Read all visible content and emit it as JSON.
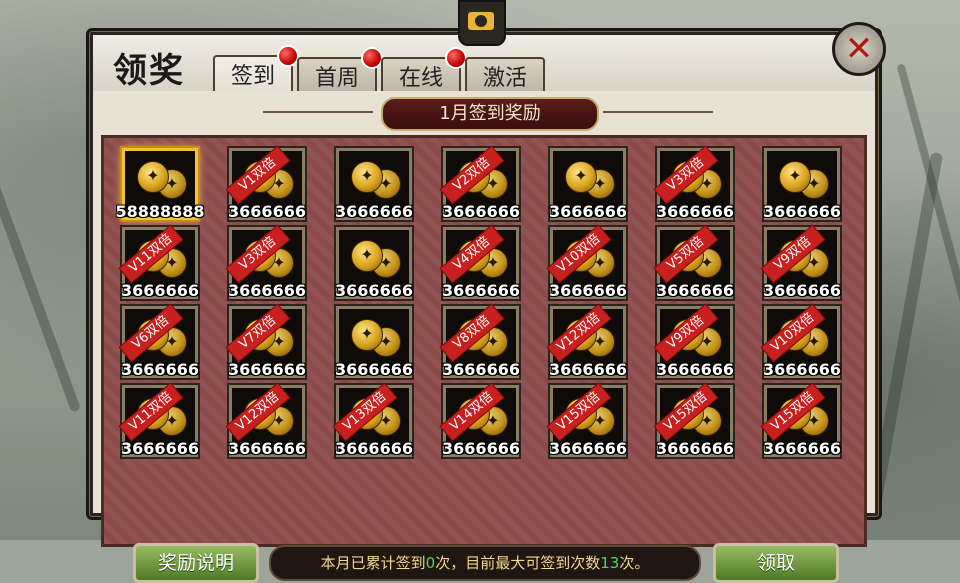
{
  "dialog": {
    "title": "领奖",
    "tabs": [
      {
        "label": "签到",
        "badge": true,
        "active": true
      },
      {
        "label": "首周",
        "badge": true,
        "active": false
      },
      {
        "label": "在线",
        "badge": true,
        "active": false
      },
      {
        "label": "激活",
        "badge": false,
        "active": false
      }
    ],
    "banner": "1月签到奖励",
    "icons": {
      "camera": "camera-icon",
      "close": "close-icon"
    }
  },
  "rewards": [
    {
      "amount": "58888888",
      "vip": "",
      "selected": true
    },
    {
      "amount": "3666666",
      "vip": "V1双倍"
    },
    {
      "amount": "3666666",
      "vip": ""
    },
    {
      "amount": "3666666",
      "vip": "V2双倍"
    },
    {
      "amount": "3666666",
      "vip": ""
    },
    {
      "amount": "3666666",
      "vip": "V3双倍"
    },
    {
      "amount": "3666666",
      "vip": ""
    },
    {
      "amount": "3666666",
      "vip": "V11双倍"
    },
    {
      "amount": "3666666",
      "vip": "V3双倍"
    },
    {
      "amount": "3666666",
      "vip": ""
    },
    {
      "amount": "3666666",
      "vip": "V4双倍"
    },
    {
      "amount": "3666666",
      "vip": "V10双倍"
    },
    {
      "amount": "3666666",
      "vip": "V5双倍"
    },
    {
      "amount": "3666666",
      "vip": "V9双倍"
    },
    {
      "amount": "3666666",
      "vip": "V6双倍"
    },
    {
      "amount": "3666666",
      "vip": "V7双倍"
    },
    {
      "amount": "3666666",
      "vip": ""
    },
    {
      "amount": "3666666",
      "vip": "V8双倍"
    },
    {
      "amount": "3666666",
      "vip": "V12双倍"
    },
    {
      "amount": "3666666",
      "vip": "V9双倍"
    },
    {
      "amount": "3666666",
      "vip": "V10双倍"
    },
    {
      "amount": "3666666",
      "vip": "V11双倍"
    },
    {
      "amount": "3666666",
      "vip": "V12双倍"
    },
    {
      "amount": "3666666",
      "vip": "V13双倍"
    },
    {
      "amount": "3666666",
      "vip": "V14双倍"
    },
    {
      "amount": "3666666",
      "vip": "V15双倍"
    },
    {
      "amount": "3666666",
      "vip": "V15双倍"
    },
    {
      "amount": "3666666",
      "vip": "V15双倍"
    }
  ],
  "footer": {
    "info_button": "奖励说明",
    "claim_button": "领取",
    "status_prefix": "本月已累计签到",
    "signed_count": "0",
    "status_middle": "次，目前最大可签到次数",
    "max_count": "13",
    "status_suffix": "次。"
  },
  "colors": {
    "accent_red": "#c8201e",
    "button_green": "#4f7a26",
    "count_green": "#4cd85a"
  }
}
